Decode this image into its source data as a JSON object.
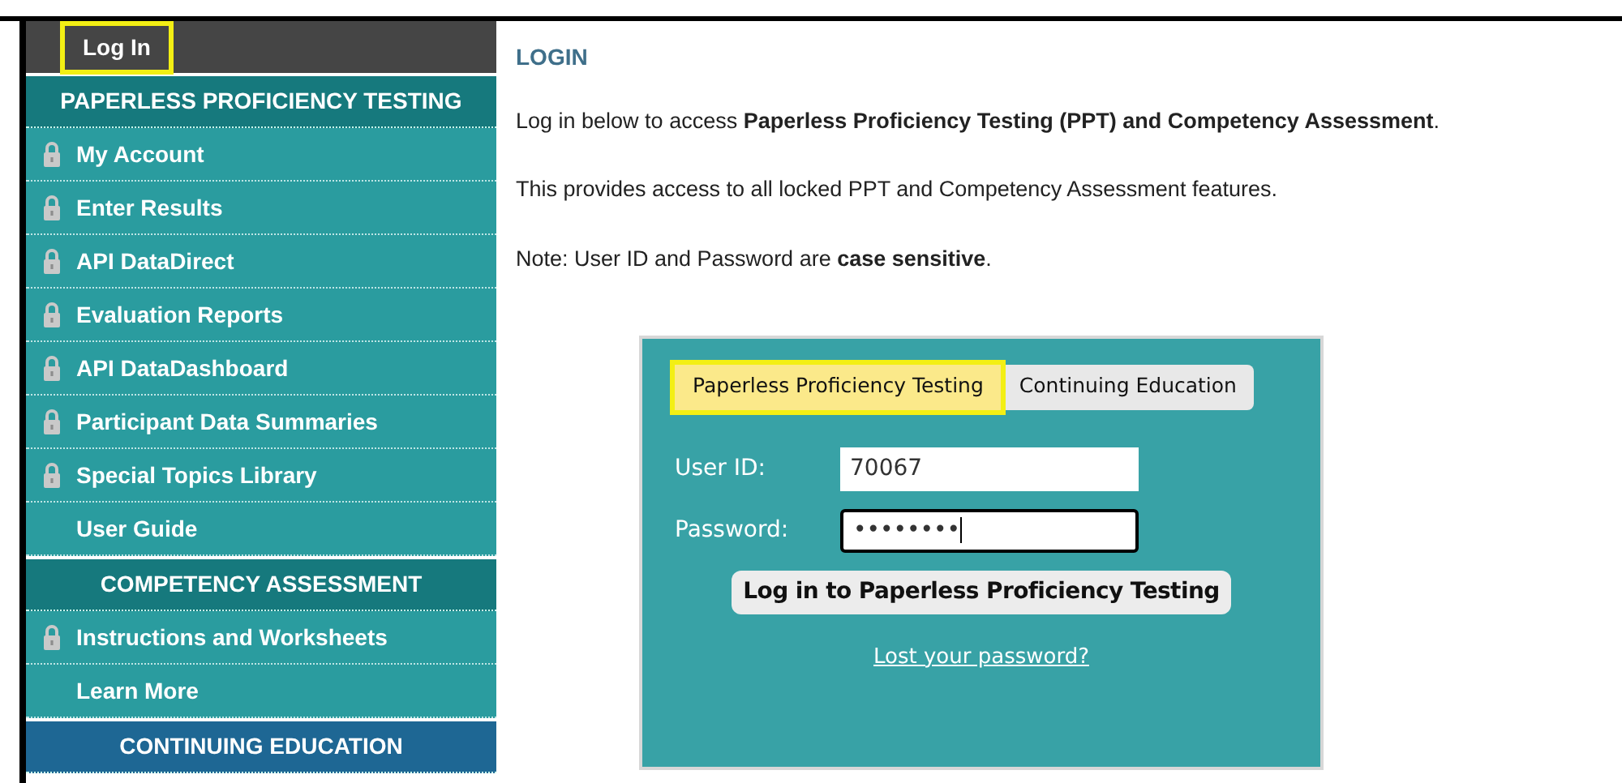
{
  "top_bar": {
    "label": "Log In",
    "highlighted": true
  },
  "sidebar": [
    {
      "kind": "header",
      "label": "PAPERLESS PROFICIENCY TESTING",
      "color": "#16797d"
    },
    {
      "kind": "link",
      "label": "My Account",
      "locked": true
    },
    {
      "kind": "link",
      "label": "Enter Results",
      "locked": true
    },
    {
      "kind": "link",
      "label": "API DataDirect",
      "locked": true
    },
    {
      "kind": "link",
      "label": "Evaluation Reports",
      "locked": true
    },
    {
      "kind": "link",
      "label": "API DataDashboard",
      "locked": true
    },
    {
      "kind": "link",
      "label": "Participant Data Summaries",
      "locked": true
    },
    {
      "kind": "link",
      "label": "Special Topics Library",
      "locked": true
    },
    {
      "kind": "link",
      "label": "User Guide",
      "locked": false
    },
    {
      "kind": "header",
      "label": "COMPETENCY ASSESSMENT",
      "color": "#16797d"
    },
    {
      "kind": "link",
      "label": "Instructions and Worksheets",
      "locked": true
    },
    {
      "kind": "link",
      "label": "Learn More",
      "locked": false
    },
    {
      "kind": "header",
      "label": "CONTINUING EDUCATION",
      "color": "#1e6794"
    }
  ],
  "heading": "LOGIN",
  "paragraphs": [
    "Log in below to access **Paperless Proficiency Testing (PPT) and Competency Assessment**.",
    "This provides access to all locked PPT and Competency Assessment features.",
    "Note: User ID and Password are **case sensitive**."
  ],
  "login_panel": {
    "tabs": [
      {
        "label": "Paperless Proficiency Testing",
        "selected": true,
        "highlighted": true
      },
      {
        "label": "Continuing Education",
        "selected": false,
        "highlighted": false
      }
    ],
    "fields": [
      {
        "label": "User ID:",
        "value": "70067",
        "focused": false
      },
      {
        "label": "Password:",
        "value": "••••••••",
        "focused": true
      }
    ],
    "button": "Log in to Paperless Proficiency Testing",
    "link": "Lost your password?"
  }
}
